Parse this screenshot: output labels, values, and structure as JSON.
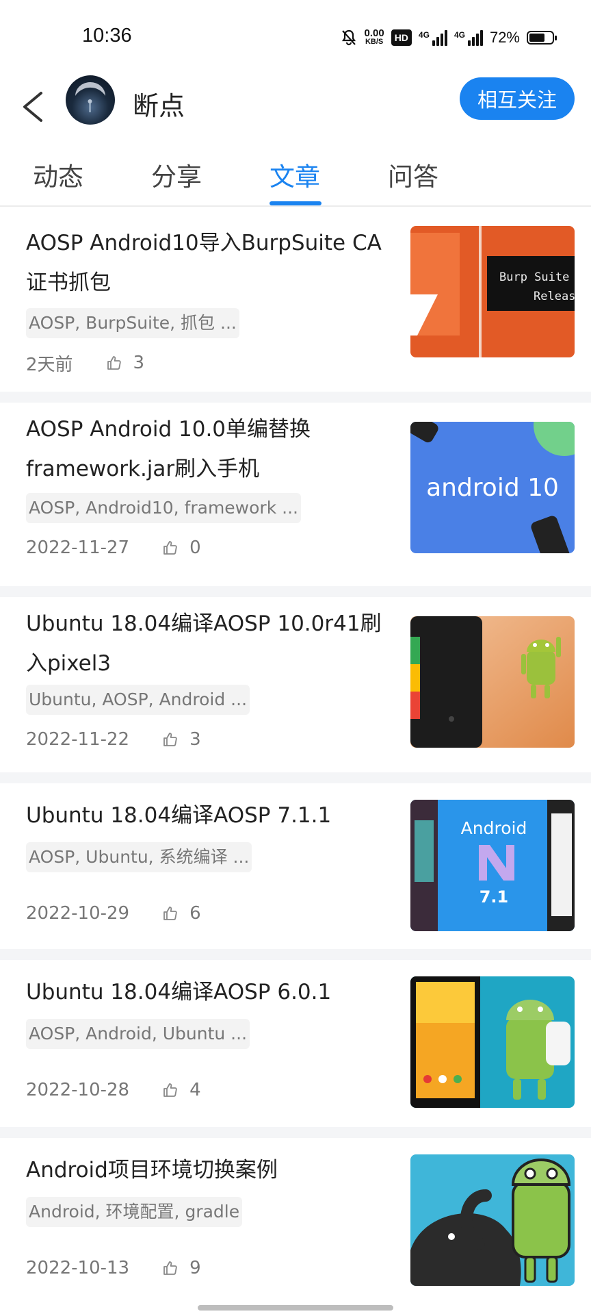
{
  "status_bar": {
    "time": "10:36",
    "net_speed": "0.00",
    "net_unit": "KB/S",
    "hd": "HD",
    "sig1": "4G",
    "sig2": "⁴⁶",
    "sig2_label": "4G",
    "battery": "72%",
    "battery_level": 0.72,
    "icons": [
      "bell-off-icon",
      "hd-icon",
      "signal-icon",
      "signal-icon",
      "battery-icon"
    ]
  },
  "header": {
    "username": "断点",
    "follow_label": "相互关注"
  },
  "tabs": [
    {
      "label": "动态",
      "active": false
    },
    {
      "label": "分享",
      "active": false
    },
    {
      "label": "文章",
      "active": true
    },
    {
      "label": "问答",
      "active": false
    }
  ],
  "articles": [
    {
      "title": "AOSP Android10导入BurpSuite CA证书抓包",
      "tags": "AOSP, BurpSuite, 抓包 ...",
      "date": "2天前",
      "likes": "3",
      "thumb_text": [
        "Burp Suite",
        "Releas"
      ]
    },
    {
      "title": "AOSP Android 10.0单编替换framework.jar刷入手机",
      "tags": "AOSP, Android10, framework ...",
      "date": "2022-11-27",
      "likes": "0",
      "thumb_text": [
        "android 10"
      ]
    },
    {
      "title": "Ubuntu 18.04编译AOSP 10.0r41刷入pixel3",
      "tags": "Ubuntu, AOSP, Android ...",
      "date": "2022-11-22",
      "likes": "3",
      "thumb_text": []
    },
    {
      "title": "Ubuntu 18.04编译AOSP 7.1.1",
      "tags": "AOSP, Ubuntu, 系统编译 ...",
      "date": "2022-10-29",
      "likes": "6",
      "thumb_text": [
        "Android",
        "7.1"
      ]
    },
    {
      "title": "Ubuntu 18.04编译AOSP 6.0.1",
      "tags": "AOSP, Android, Ubuntu ...",
      "date": "2022-10-28",
      "likes": "4",
      "thumb_text": []
    },
    {
      "title": "Android项目环境切换案例",
      "tags": "Android, 环境配置, gradle",
      "date": "2022-10-13",
      "likes": "9",
      "thumb_text": []
    }
  ],
  "colors": {
    "accent": "#1a83f0",
    "separator": "#f4f5f7"
  }
}
